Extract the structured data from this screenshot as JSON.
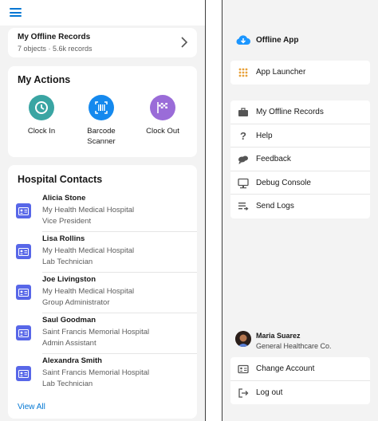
{
  "colors": {
    "brand": "#0176d3",
    "clock_in": "#3aa5a3",
    "barcode": "#1589ee",
    "clock_out": "#9a6cd8",
    "contact_icon": "#5867e8"
  },
  "left": {
    "records": {
      "title": "My Offline Records",
      "subtitle": "7 objects · 5.6k records"
    },
    "actions": {
      "title": "My Actions",
      "items": [
        {
          "label": "Clock In",
          "icon": "clock-icon"
        },
        {
          "label": "Barcode Scanner",
          "icon": "barcode-icon"
        },
        {
          "label": "Clock Out",
          "icon": "flag-icon"
        }
      ]
    },
    "contacts": {
      "title": "Hospital Contacts",
      "items": [
        {
          "name": "Alicia Stone",
          "org": "My Health Medical Hospital",
          "role": "Vice President"
        },
        {
          "name": "Lisa Rollins",
          "org": "My Health Medical Hospital",
          "role": "Lab Technician"
        },
        {
          "name": "Joe Livingston",
          "org": "My Health Medical Hospital",
          "role": "Group Administrator"
        },
        {
          "name": "Saul Goodman",
          "org": "Saint Francis Memorial Hospital",
          "role": "Admin Assistant"
        },
        {
          "name": "Alexandra Smith",
          "org": "Saint Francis Memorial Hospital",
          "role": "Lab Technician"
        }
      ],
      "view_all": "View All"
    }
  },
  "right": {
    "app_title": "Offline App",
    "launcher": "App Launcher",
    "menu": [
      "My Offline Records",
      "Help",
      "Feedback",
      "Debug Console",
      "Send Logs"
    ],
    "user": {
      "name": "Maria Suarez",
      "org": "General Healthcare Co."
    },
    "account": [
      "Change Account",
      "Log out"
    ]
  }
}
